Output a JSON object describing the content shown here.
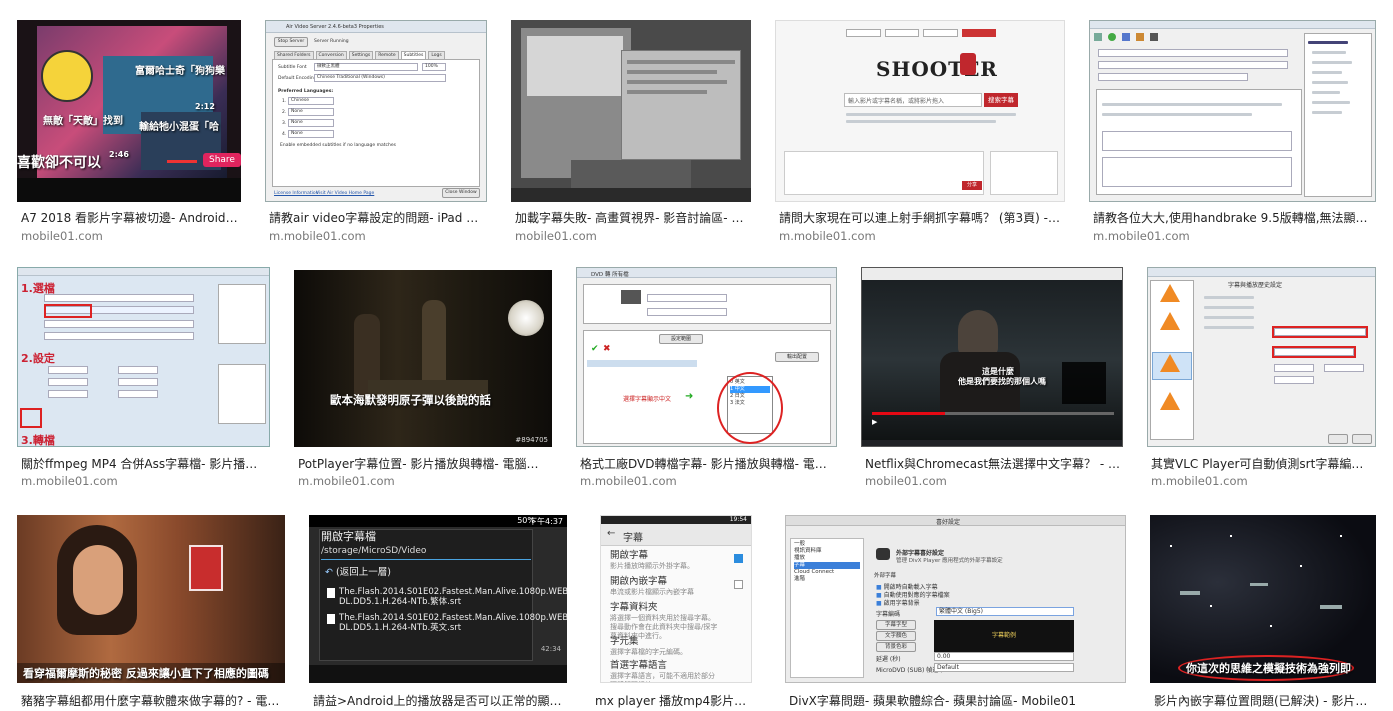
{
  "results": [
    {
      "caption": "A7 2018 看影片字幕被切邊- Android手機- 手機討論區- Mobile01",
      "domain": "mobile01.com"
    },
    {
      "caption": "請教air video字幕設定的問題- iPad 討論區- Mobile01",
      "domain": "m.mobile01.com"
    },
    {
      "caption": "加載字幕失敗- 高畫質視界- 影音討論區- Mobile01",
      "domain": "mobile01.com"
    },
    {
      "caption": "請問大家現在可以連上射手網抓字幕嗎？ (第3頁) - 電腦軟體",
      "domain": "m.mobile01.com"
    },
    {
      "caption": "請教各位大大,使用handbrake 9.5版轉檔,無法顯示字幕",
      "domain": "m.mobile01.com"
    },
    {
      "caption": "關於ffmpeg MP4 合併Ass字幕檔- 影片播放與轉檔- 電腦",
      "domain": "m.mobile01.com"
    },
    {
      "caption": "PotPlayer字幕位置- 影片播放與轉檔- 電腦軟體",
      "domain": "m.mobile01.com"
    },
    {
      "caption": "格式工廠DVD轉檔字幕- 影片播放與轉檔- 電腦軟體",
      "domain": "m.mobile01.com"
    },
    {
      "caption": "Netflix與Chromecast無法選擇中文字幕？ - 影音",
      "domain": "mobile01.com"
    },
    {
      "caption": "其實VLC Player可自動偵測srt字幕編碼- 電腦軟體",
      "domain": "m.mobile01.com"
    },
    {
      "caption": "豬豬字幕組都用什麼字幕軟體來做字幕的? - 電腦軟體",
      "domain": ""
    },
    {
      "caption": "請益>Android上的播放器是否可以正常的顯示字幕",
      "domain": ""
    },
    {
      "caption": "mx player 播放mp4影片如何外掛字幕",
      "domain": ""
    },
    {
      "caption": "DivX字幕問題- 蘋果軟體綜合- 蘋果討論區- Mobile01",
      "domain": ""
    },
    {
      "caption": "影片內嵌字幕位置問題(已解決) - 影片播放與轉檔",
      "domain": ""
    }
  ],
  "thumbs": {
    "t1": {
      "sub1": "富爾哈士奇「狗狗樂",
      "sub2": "無敵「天敵」找到",
      "sub3": "輸給牠小混蛋「哈",
      "sub4": "喜歡卻不可以",
      "share": "Share",
      "time1": "2:12",
      "time2": "2:46"
    },
    "t2": {
      "title": "Air Video Server 2.4.6-beta3 Properties",
      "btn_stop": "Stop Server",
      "status": "Server Running",
      "tabs": [
        "Shared Folders",
        "Conversion",
        "Settings",
        "Remote",
        "Subtitles",
        "Logs"
      ],
      "font_label": "Subtitle Font",
      "font_value": "微軟正黑體",
      "font_pct": "100%",
      "enc_label": "Default Encoding",
      "enc_value": "Chinese Traditional (Windows)",
      "pref_label": "Preferred Languages:",
      "langs": [
        "1.",
        "2.",
        "3.",
        "4."
      ],
      "lang_values": [
        "Chinese",
        "None",
        "None",
        "None"
      ],
      "embed": "Enable embedded subtitles if no language matches",
      "license": "License Information",
      "visit": "Visit Air Video Home Page",
      "close": "Close Window"
    },
    "t4": {
      "logo": "SHOOTER",
      "search_btn": "搜索字幕",
      "search_ph": "輸入影片或字幕名稱，或將影片拖入",
      "share_btn": "分享"
    },
    "t6": {
      "sec1": "1.選檔",
      "sec2": "2.設定",
      "sec3": "3.轉檔"
    },
    "t7": {
      "subtitle": "歐本海默發明原子彈以後說的話",
      "watermark": "#894705"
    },
    "t8": {
      "title": "DVD 轉 所有檔",
      "hint": "選擇字幕顯示中文",
      "btn1": "設定範圍",
      "btn2": "輸出配置",
      "options": [
        "0 英文",
        "1 中文",
        "2 日文",
        "3 法文"
      ]
    },
    "t9": {
      "subtitle1": "這是什麼",
      "subtitle2": "他是我們要找的那個人嗎"
    },
    "t10": {
      "title": "字幕與播放歷史設定"
    },
    "t11": {
      "subtitle": "看穿福爾摩斯的秘密 反過來讓小直下了相應的圖碼"
    },
    "t12": {
      "status": "50%",
      "clock": "下午4:37",
      "title": "開啟字幕檔",
      "path": "/storage/MicroSD/Video",
      "up": "(返回上一層)",
      "file1": "The.Flash.2014.S01E02.Fastest.Man.Alive.1080p.WEB-DL.DD5.1.H.264-NTb.繁体.srt",
      "file2": "The.Flash.2014.S01E02.Fastest.Man.Alive.1080p.WEB-DL.DD5.1.H.264-NTb.英文.srt",
      "time": "42:34"
    },
    "t13": {
      "clock": "19:54",
      "header": "字幕",
      "items": [
        {
          "title": "開啟字幕",
          "sub": "影片播放時顯示外掛字幕。"
        },
        {
          "title": "開啟內嵌字幕",
          "sub": "串流或影片檔顯示內嵌字幕"
        },
        {
          "title": "字幕資料夾",
          "sub": "將選擇一個資料夾用於搜尋字幕。搜尋動作會在此資料夾中搜尋/探字幕資料夾中進行。"
        },
        {
          "title": "字元集",
          "sub": "選擇字幕檔的字元編碼。"
        },
        {
          "title": "首選字幕語言",
          "sub": "選擇字幕語言，可能不適用於部分硬體解碼播放。"
        }
      ]
    },
    "t14": {
      "title": "喜好設定",
      "heading": "外部字幕喜好設定",
      "desc": "管理 DivX Player 應用程式的外部字幕設定",
      "side": [
        "一般",
        "視訊資料庫",
        "播放",
        "字幕",
        "Cloud Connect",
        "進階"
      ],
      "group": "外部字幕",
      "opt1": "開啟時自動載入字幕",
      "opt2": "自動使用對應的字幕檔案",
      "opt3": "啟用字幕背景",
      "enc_label": "字幕編碼",
      "enc_value": "繁體中文 (Big5)",
      "btn1": "字幕字型",
      "btn2": "文字顏色",
      "btn3": "背景色彩",
      "preview": "字幕範例",
      "delay_label": "延遲 (秒)",
      "delay_value": "0.00",
      "format_label": "MicroDVD (SUB) 幀速率",
      "format_value": "Default"
    },
    "t15": {
      "subtitle": "你這次的思維之模擬技術為強列即"
    }
  }
}
